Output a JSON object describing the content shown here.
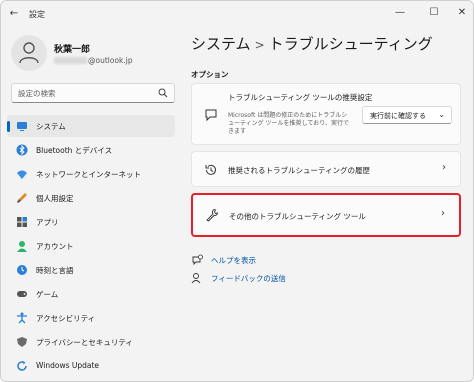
{
  "window": {
    "title": "設定",
    "back_icon": "back-arrow-icon",
    "controls": {
      "minimize": "—",
      "maximize": "☐",
      "close": "✕"
    }
  },
  "user": {
    "name": "秋葉一郎",
    "email_suffix": "@outlook.jp"
  },
  "search": {
    "placeholder": "設定の検索"
  },
  "sidebar": {
    "items": [
      {
        "label": "システム",
        "icon": "system-icon",
        "selected": true
      },
      {
        "label": "Bluetooth とデバイス",
        "icon": "bluetooth-icon"
      },
      {
        "label": "ネットワークとインターネット",
        "icon": "wifi-icon"
      },
      {
        "label": "個人用設定",
        "icon": "brush-icon"
      },
      {
        "label": "アプリ",
        "icon": "apps-icon"
      },
      {
        "label": "アカウント",
        "icon": "account-icon"
      },
      {
        "label": "時刻と言語",
        "icon": "globe-clock-icon"
      },
      {
        "label": "ゲーム",
        "icon": "gamepad-icon"
      },
      {
        "label": "アクセシビリティ",
        "icon": "accessibility-icon"
      },
      {
        "label": "プライバシーとセキュリティ",
        "icon": "shield-icon"
      },
      {
        "label": "Windows Update",
        "icon": "update-icon"
      }
    ]
  },
  "main": {
    "breadcrumb_parent": "システム",
    "breadcrumb_separator": ">",
    "breadcrumb_current": "トラブルシューティング",
    "section_label": "オプション",
    "cards": [
      {
        "title": "トラブルシューティング ツールの推奨設定",
        "description": "Microsoft は問題の修正のためにトラブルシューティング ツールを推奨しており、実行できます",
        "dropdown_value": "実行前に確認する",
        "icon": "chat-icon"
      },
      {
        "title": "推奨されるトラブルシューティングの履歴",
        "icon": "history-icon"
      },
      {
        "title": "その他のトラブルシューティング ツール",
        "icon": "wrench-icon",
        "highlighted": true
      }
    ],
    "links": [
      {
        "label": "ヘルプを表示",
        "icon": "help-icon"
      },
      {
        "label": "フィードバックの送信",
        "icon": "feedback-icon"
      }
    ]
  },
  "colors": {
    "accent": "#0067c0",
    "highlight_border": "#e3202c",
    "link": "#0050a0"
  }
}
